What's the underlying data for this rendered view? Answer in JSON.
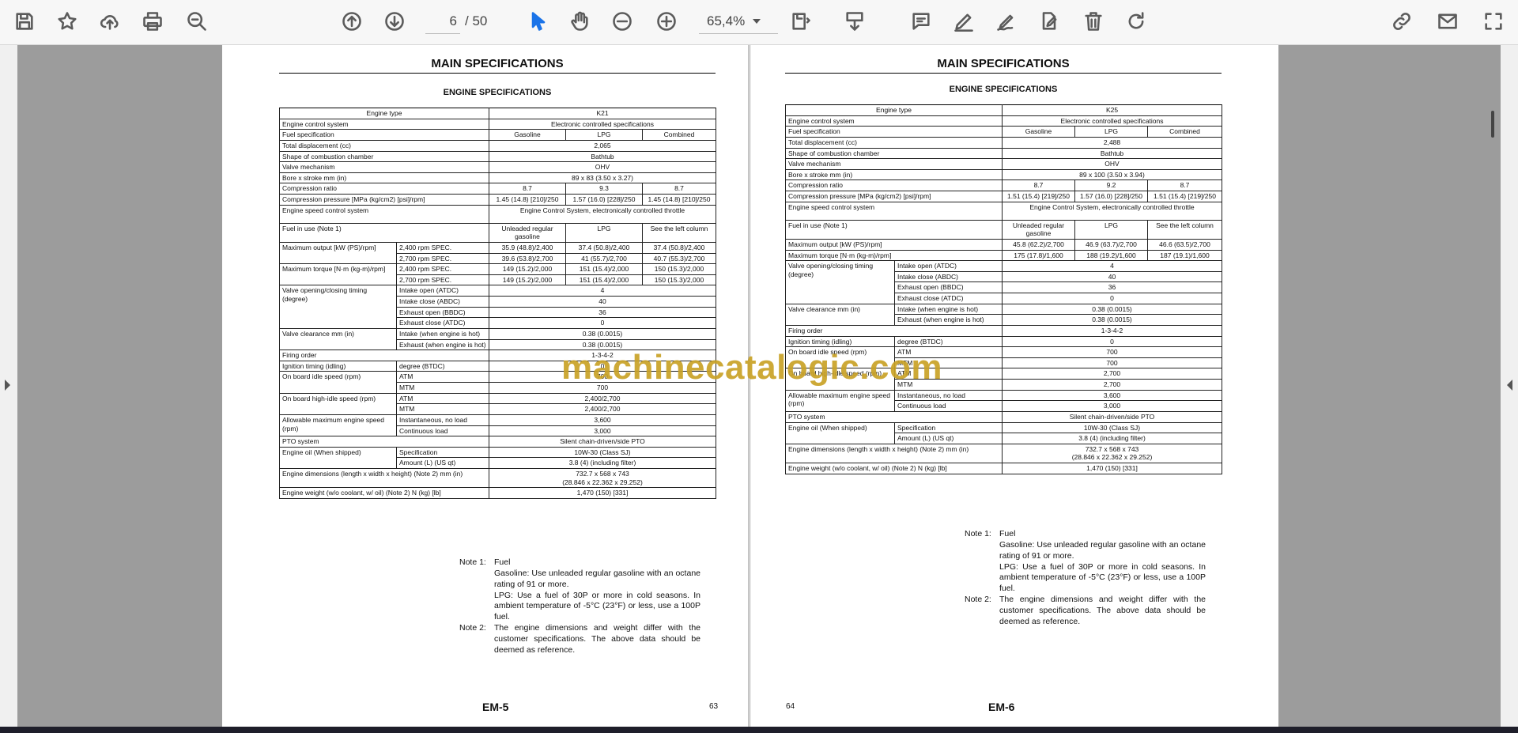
{
  "toolbar": {
    "page_current": "6",
    "page_sep": "/",
    "page_total": "50",
    "zoom": "65,4%",
    "icons": [
      "save-icon",
      "star-icon",
      "upload-icon",
      "print-icon",
      "zoom-out-search-icon",
      "page-up-icon",
      "page-down-icon",
      "select-cursor-icon",
      "hand-icon",
      "zoom-minus-icon",
      "zoom-plus-icon",
      "view-mode-icon",
      "download-icon",
      "comment-icon",
      "pen-icon",
      "sign-icon",
      "edit-doc-icon",
      "trash-icon",
      "redo-icon",
      "link-icon",
      "mail-icon",
      "expand-icon"
    ]
  },
  "watermark": "machinecatalogic.com",
  "left_page": {
    "title": "MAIN SPECIFICATIONS",
    "subtitle": "ENGINE SPECIFICATIONS",
    "footer": "EM-5",
    "page_number": "63",
    "rows": {
      "engine_type": [
        "Engine type",
        "K21"
      ],
      "control": [
        "Engine control system",
        "Electronic controlled specifications"
      ],
      "fuel": [
        "Fuel specification",
        "Gasoline",
        "LPG",
        "Combined"
      ],
      "displacement": [
        "Total displacement (cc)",
        "2,065"
      ],
      "chamber": [
        "Shape of combustion chamber",
        "Bathtub"
      ],
      "valve": [
        "Valve mechanism",
        "OHV"
      ],
      "bore": [
        "Bore x stroke mm (in)",
        "89 x 83 (3.50 x 3.27)"
      ],
      "compression": [
        "Compression ratio",
        "8.7",
        "9.3",
        "8.7"
      ],
      "comp_pressure": [
        "Compression pressure [MPa (kg/cm2) [psi]/rpm]",
        "1.45 (14.8) [210]/250",
        "1.57 (16.0) [228]/250",
        "1.45 (14.8) [210]/250"
      ],
      "speed_control": [
        "Engine speed control system",
        "Engine Control System, electronically controlled throttle"
      ],
      "fuel_use": [
        "Fuel in use (Note 1)",
        "Unleaded regular gasoline",
        "LPG",
        "See the left column"
      ],
      "max_output": [
        "Maximum output [kW (PS)/rpm]",
        "2,400 rpm SPEC.",
        "35.9 (48.8)/2,400",
        "37.4 (50.8)/2,400",
        "37.4 (50.8)/2,400",
        "2,700 rpm SPEC.",
        "39.6 (53.8)/2,700",
        "41 (55.7)/2,700",
        "40.7 (55.3)/2,700"
      ],
      "max_torque": [
        "Maximum torque [N·m (kg-m)/rpm]",
        "2,400 rpm SPEC.",
        "149 (15.2)/2,000",
        "151 (15.4)/2,000",
        "150 (15.3)/2,000",
        "2,700 rpm SPEC.",
        "149 (15.2)/2,000",
        "151 (15.4)/2,000",
        "150 (15.3)/2,000"
      ],
      "valve_timing": [
        "Valve opening/closing timing (degree)",
        "Intake open (ATDC)",
        "4",
        "Intake close (ABDC)",
        "40",
        "Exhaust open (BBDC)",
        "36",
        "Exhaust close (ATDC)",
        "0"
      ],
      "valve_clearance": [
        "Valve clearance mm (in)",
        "Intake (when engine is hot)",
        "0.38 (0.0015)",
        "Exhaust (when engine is hot)",
        "0.38 (0.0015)"
      ],
      "firing": [
        "Firing order",
        "1-3-4-2"
      ],
      "ignition": [
        "Ignition timing (idling)",
        "degree (BTDC)",
        "0"
      ],
      "idle": [
        "On board idle speed (rpm)",
        "ATM",
        "700",
        "MTM",
        "700"
      ],
      "high_idle": [
        "On board high-idle speed (rpm)",
        "ATM",
        "2,400/2,700",
        "MTM",
        "2,400/2,700"
      ],
      "allow_max": [
        "Allowable maximum engine speed (rpm)",
        "Instantaneous, no load",
        "3,600",
        "Continuous load",
        "3,000"
      ],
      "pto": [
        "PTO system",
        "Silent chain-driven/side PTO"
      ],
      "oil": [
        "Engine oil (When shipped)",
        "Specification",
        "10W-30 (Class SJ)",
        "Amount (L) (US qt)",
        "3.8 (4) (including filter)"
      ],
      "dimensions": [
        "Engine dimensions (length x width x height) (Note 2) mm (in)",
        "732.7 x 568 x 743",
        "(28.846 x 22.362 x 29.252)"
      ],
      "weight": [
        "Engine weight (w/o coolant, w/ oil) (Note 2) N (kg) [lb]",
        "1,470 (150) [331]"
      ]
    }
  },
  "right_page": {
    "title": "MAIN SPECIFICATIONS",
    "subtitle": "ENGINE SPECIFICATIONS",
    "footer": "EM-6",
    "page_number": "64",
    "rows": {
      "engine_type": [
        "Engine type",
        "K25"
      ],
      "control": [
        "Engine control system",
        "Electronic controlled specifications"
      ],
      "fuel": [
        "Fuel specification",
        "Gasoline",
        "LPG",
        "Combined"
      ],
      "displacement": [
        "Total displacement (cc)",
        "2,488"
      ],
      "chamber": [
        "Shape of combustion chamber",
        "Bathtub"
      ],
      "valve": [
        "Valve mechanism",
        "OHV"
      ],
      "bore": [
        "Bore x stroke mm (in)",
        "89 x 100 (3.50 x 3.94)"
      ],
      "compression": [
        "Compression ratio",
        "8.7",
        "9.2",
        "8.7"
      ],
      "comp_pressure": [
        "Compression pressure [MPa (kg/cm2) [psi]/rpm]",
        "1.51 (15.4) [219]/250",
        "1.57 (16.0) [228]/250",
        "1.51 (15.4) [219]/250"
      ],
      "speed_control": [
        "Engine speed control system",
        "Engine Control System, electronically controlled throttle"
      ],
      "fuel_use": [
        "Fuel in use (Note 1)",
        "Unleaded regular gasoline",
        "LPG",
        "See the left column"
      ],
      "max_output": [
        "Maximum output [kW (PS)/rpm]",
        "45.8 (62.2)/2,700",
        "46.9 (63.7)/2,700",
        "46.6 (63.5)/2,700"
      ],
      "max_torque": [
        "Maximum torque [N·m (kg-m)/rpm]",
        "175 (17.8)/1,600",
        "188 (19.2)/1,600",
        "187 (19.1)/1,600"
      ],
      "valve_timing": [
        "Valve opening/closing timing (degree)",
        "Intake open (ATDC)",
        "4",
        "Intake close (ABDC)",
        "40",
        "Exhaust open (BBDC)",
        "36",
        "Exhaust close (ATDC)",
        "0"
      ],
      "valve_clearance": [
        "Valve clearance mm (in)",
        "Intake (when engine is hot)",
        "0.38 (0.0015)",
        "Exhaust (when engine is hot)",
        "0.38 (0.0015)"
      ],
      "firing": [
        "Firing order",
        "1-3-4-2"
      ],
      "ignition": [
        "Ignition timing (idling)",
        "degree (BTDC)",
        "0"
      ],
      "idle": [
        "On board idle speed (rpm)",
        "ATM",
        "700",
        "MTM",
        "700"
      ],
      "high_idle": [
        "On board high-idle speed (rpm)",
        "ATM",
        "2,700",
        "MTM",
        "2,700"
      ],
      "allow_max": [
        "Allowable maximum engine speed (rpm)",
        "Instantaneous, no load",
        "3,600",
        "Continuous load",
        "3,000"
      ],
      "pto": [
        "PTO system",
        "Silent chain-driven/side PTO"
      ],
      "oil": [
        "Engine oil (When shipped)",
        "Specification",
        "10W-30 (Class SJ)",
        "Amount (L) (US qt)",
        "3.8 (4) (including filter)"
      ],
      "dimensions": [
        "Engine dimensions (length x width x height) (Note 2) mm (in)",
        "732.7 x 568 x 743",
        "(28.846 x 22.362 x 29.252)"
      ],
      "weight": [
        "Engine weight (w/o coolant, w/ oil) (Note 2) N (kg) [lb]",
        "1,470 (150) [331]"
      ]
    }
  },
  "notes": {
    "note1_label": "Note 1:",
    "note1_title": "Fuel",
    "note1_gasoline": "Gasoline: Use unleaded regular gasoline with an octane rating of 91 or more.",
    "note1_lpg": "LPG: Use a fuel of 30P or more in cold seasons. In ambient temperature of -5°C (23°F) or less, use a 100P fuel.",
    "note2_label": "Note 2:",
    "note2_text": "The engine dimensions and weight differ with the customer specifications. The above data should be deemed as reference."
  }
}
